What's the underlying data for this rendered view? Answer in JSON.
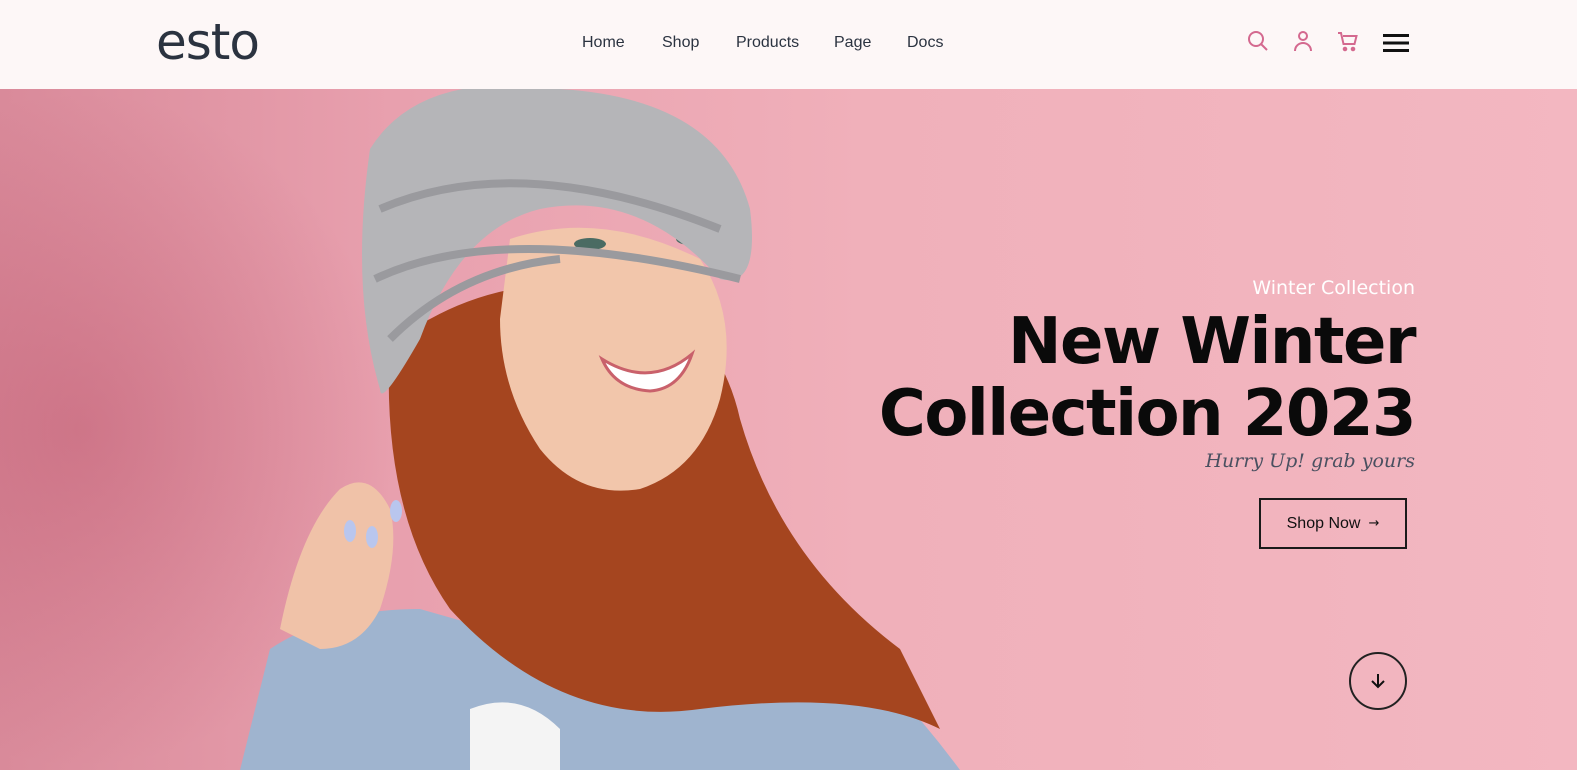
{
  "header": {
    "logo": "esto",
    "nav": [
      {
        "label": "Home"
      },
      {
        "label": "Shop"
      },
      {
        "label": "Products"
      },
      {
        "label": "Page"
      },
      {
        "label": "Docs"
      }
    ],
    "icons": {
      "search": "search-icon",
      "user": "user-icon",
      "cart": "cart-icon",
      "menu": "hamburger-menu-icon"
    },
    "accent_color": "#d4698f"
  },
  "hero": {
    "eyebrow": "Winter Collection",
    "title_line1": "New Winter",
    "title_line2": "Collection 2023",
    "subtitle": "Hurry Up! grab yours",
    "cta_label": "Shop Now",
    "cta_icon": "arrow-right-icon",
    "scroll_icon": "arrow-down-icon",
    "background_color": "#f0b0ba"
  }
}
